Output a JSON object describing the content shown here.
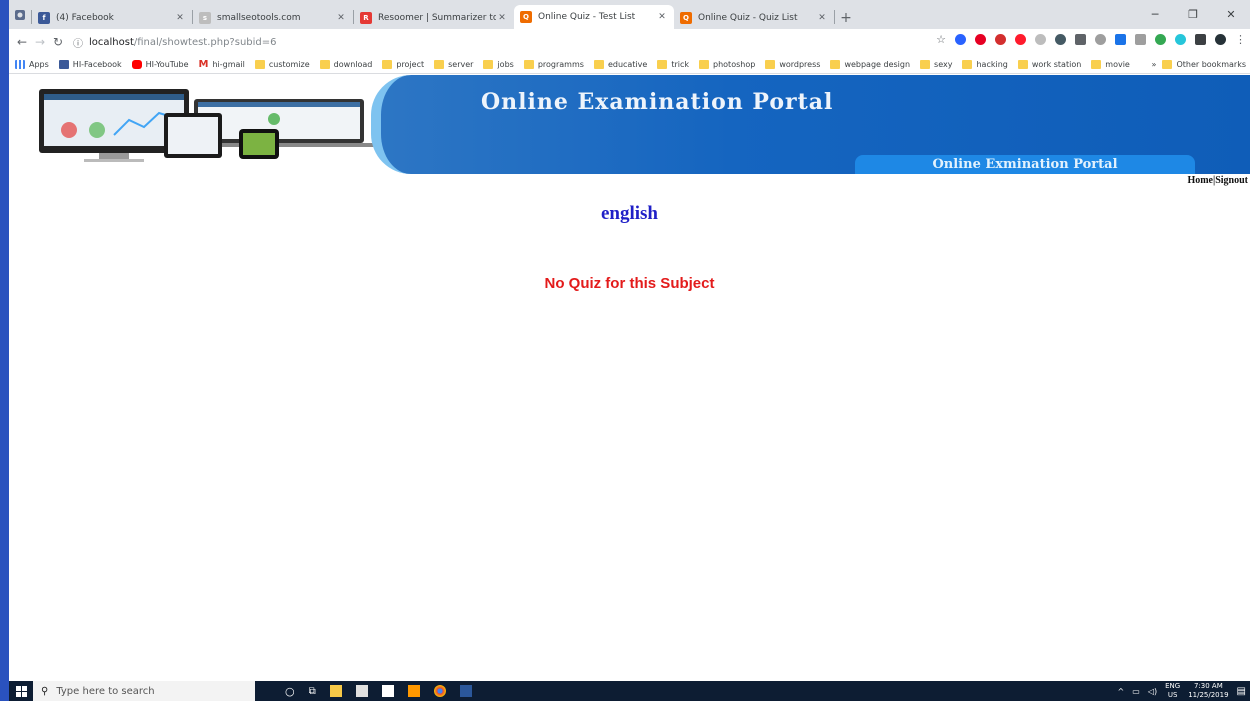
{
  "browser": {
    "tabs": [
      {
        "title": "(4) Facebook",
        "favicon": "facebook-icon",
        "color": "#3b5998",
        "active": false
      },
      {
        "title": "smallseotools.com",
        "favicon": "smallseotools-icon",
        "color": "#9e9e9e",
        "active": false
      },
      {
        "title": "Resoomer | Summarizer to make",
        "favicon": "resoomer-icon",
        "color": "#e53935",
        "active": false
      },
      {
        "title": "Online Quiz - Test List",
        "favicon": "quiz-icon",
        "color": "#ef6c00",
        "active": true
      },
      {
        "title": "Online Quiz - Quiz List",
        "favicon": "quiz-icon",
        "color": "#ef6c00",
        "active": false
      }
    ],
    "new_tab": "+",
    "address": {
      "host": "localhost",
      "path": "/final/showtest.php?subid=6"
    },
    "bookmarks": [
      {
        "label": "Apps",
        "icon": "apps-icon",
        "color": "#4285f4"
      },
      {
        "label": "HI-Facebook",
        "icon": "facebook-icon",
        "color": "#3b5998"
      },
      {
        "label": "HI-YouTube",
        "icon": "youtube-icon",
        "color": "#ff0000"
      },
      {
        "label": "hi-gmail",
        "icon": "gmail-icon",
        "color": "#d93025"
      },
      {
        "label": "customize",
        "icon": "folder-icon",
        "color": "#f9cf4e"
      },
      {
        "label": "download",
        "icon": "folder-icon",
        "color": "#f9cf4e"
      },
      {
        "label": "project",
        "icon": "folder-icon",
        "color": "#f9cf4e"
      },
      {
        "label": "server",
        "icon": "folder-icon",
        "color": "#f9cf4e"
      },
      {
        "label": "jobs",
        "icon": "folder-icon",
        "color": "#f9cf4e"
      },
      {
        "label": "programms",
        "icon": "folder-icon",
        "color": "#f9cf4e"
      },
      {
        "label": "educative",
        "icon": "folder-icon",
        "color": "#f9cf4e"
      },
      {
        "label": "trick",
        "icon": "folder-icon",
        "color": "#f9cf4e"
      },
      {
        "label": "photoshop",
        "icon": "folder-icon",
        "color": "#f9cf4e"
      },
      {
        "label": "wordpress",
        "icon": "folder-icon",
        "color": "#f9cf4e"
      },
      {
        "label": "webpage design",
        "icon": "folder-icon",
        "color": "#f9cf4e"
      },
      {
        "label": "sexy",
        "icon": "folder-icon",
        "color": "#f9cf4e"
      },
      {
        "label": "hacking",
        "icon": "folder-icon",
        "color": "#f9cf4e"
      },
      {
        "label": "work station",
        "icon": "folder-icon",
        "color": "#f9cf4e"
      },
      {
        "label": "movie",
        "icon": "folder-icon",
        "color": "#f9cf4e"
      }
    ],
    "more_bookmarks": "»",
    "other_bookmarks": "Other bookmarks"
  },
  "page": {
    "banner_title": "Online Examination Portal",
    "banner_subtitle": "Online Exmination Portal",
    "nav": {
      "home": "Home",
      "separator": "|",
      "signout": "Signout"
    },
    "subject": "english",
    "message": "No Quiz for this Subject",
    "colors": {
      "subject": "#1f1fc7",
      "message": "#e31b1b",
      "banner": "#1565c0"
    }
  },
  "taskbar": {
    "search_placeholder": "Type here to search",
    "language": "ENG",
    "region": "US",
    "time": "7:30 AM",
    "date": "11/25/2019"
  }
}
